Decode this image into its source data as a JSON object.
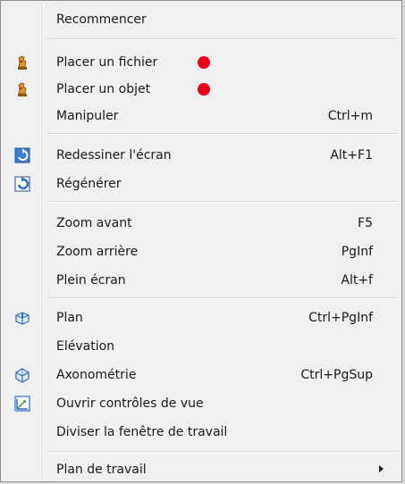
{
  "menu": {
    "items": [
      {
        "label": "Recommencer"
      },
      {
        "label": "Placer un fichier",
        "icon": "chess-piece-icon"
      },
      {
        "label": "Placer un objet",
        "icon": "chess-piece-icon"
      },
      {
        "label": "Manipuler",
        "shortcut": "Ctrl+m"
      },
      {
        "label": "Redessiner l'écran",
        "shortcut": "Alt+F1",
        "icon": "redraw-icon"
      },
      {
        "label": "Régénérer",
        "icon": "regenerate-icon"
      },
      {
        "label": "Zoom avant",
        "shortcut": "F5"
      },
      {
        "label": "Zoom arrière",
        "shortcut": "PgInf"
      },
      {
        "label": "Plein écran",
        "shortcut": "Alt+f"
      },
      {
        "label": "Plan",
        "shortcut": "Ctrl+PgInf",
        "icon": "plan-view-icon"
      },
      {
        "label": "Elévation"
      },
      {
        "label": "Axonométrie",
        "shortcut": "Ctrl+PgSup",
        "icon": "axonometric-icon"
      },
      {
        "label": "Ouvrir contrôles de vue",
        "icon": "view-controls-icon"
      },
      {
        "label": "Diviser la fenêtre de travail"
      },
      {
        "label": "Plan de travail",
        "submenu": true
      }
    ]
  },
  "colors": {
    "menu_background": "#f0f0f0",
    "marker_dot": "#e8001a",
    "icon_blue": "#2f6fc2"
  }
}
